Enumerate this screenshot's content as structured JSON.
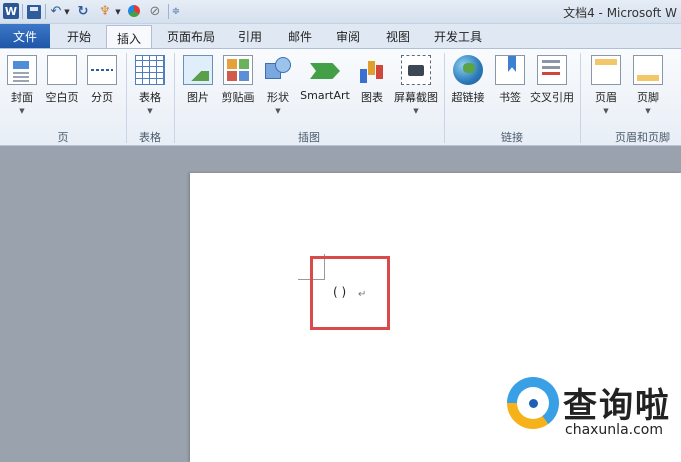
{
  "window": {
    "title": "文档4 - Microsoft W"
  },
  "quick_access": {
    "word_icon": "W"
  },
  "tabs": [
    {
      "label": "文件"
    },
    {
      "label": "开始"
    },
    {
      "label": "插入"
    },
    {
      "label": "页面布局"
    },
    {
      "label": "引用"
    },
    {
      "label": "邮件"
    },
    {
      "label": "审阅"
    },
    {
      "label": "视图"
    },
    {
      "label": "开发工具"
    }
  ],
  "active_tab": "插入",
  "ribbon": {
    "groups": [
      {
        "label": "页"
      },
      {
        "label": "表格"
      },
      {
        "label": "插图"
      },
      {
        "label": "链接"
      },
      {
        "label": "页眉和页脚"
      }
    ],
    "buttons": [
      {
        "label": "封面",
        "icon": "cover-page-icon"
      },
      {
        "label": "空白页",
        "icon": "blank-page-icon"
      },
      {
        "label": "分页",
        "icon": "page-break-icon"
      },
      {
        "label": "表格",
        "icon": "table-icon"
      },
      {
        "label": "图片",
        "icon": "picture-icon"
      },
      {
        "label": "剪贴画",
        "icon": "clip-art-icon"
      },
      {
        "label": "形状",
        "icon": "shapes-icon"
      },
      {
        "label": "SmartArt",
        "icon": "smartart-icon"
      },
      {
        "label": "图表",
        "icon": "chart-icon"
      },
      {
        "label": "屏幕截图",
        "icon": "screenshot-icon"
      },
      {
        "label": "超链接",
        "icon": "hyperlink-icon"
      },
      {
        "label": "书签",
        "icon": "bookmark-icon"
      },
      {
        "label": "交叉引用",
        "icon": "cross-reference-icon"
      },
      {
        "label": "页眉",
        "icon": "header-icon"
      },
      {
        "label": "页脚",
        "icon": "footer-icon"
      }
    ]
  },
  "document": {
    "content": "( )",
    "paragraph_mark": "↵"
  },
  "watermark": {
    "title": "查询啦",
    "url": "chaxunla.com"
  },
  "colors": {
    "highlight": "#d94a4a",
    "file_tab": "#2b5fb0"
  }
}
